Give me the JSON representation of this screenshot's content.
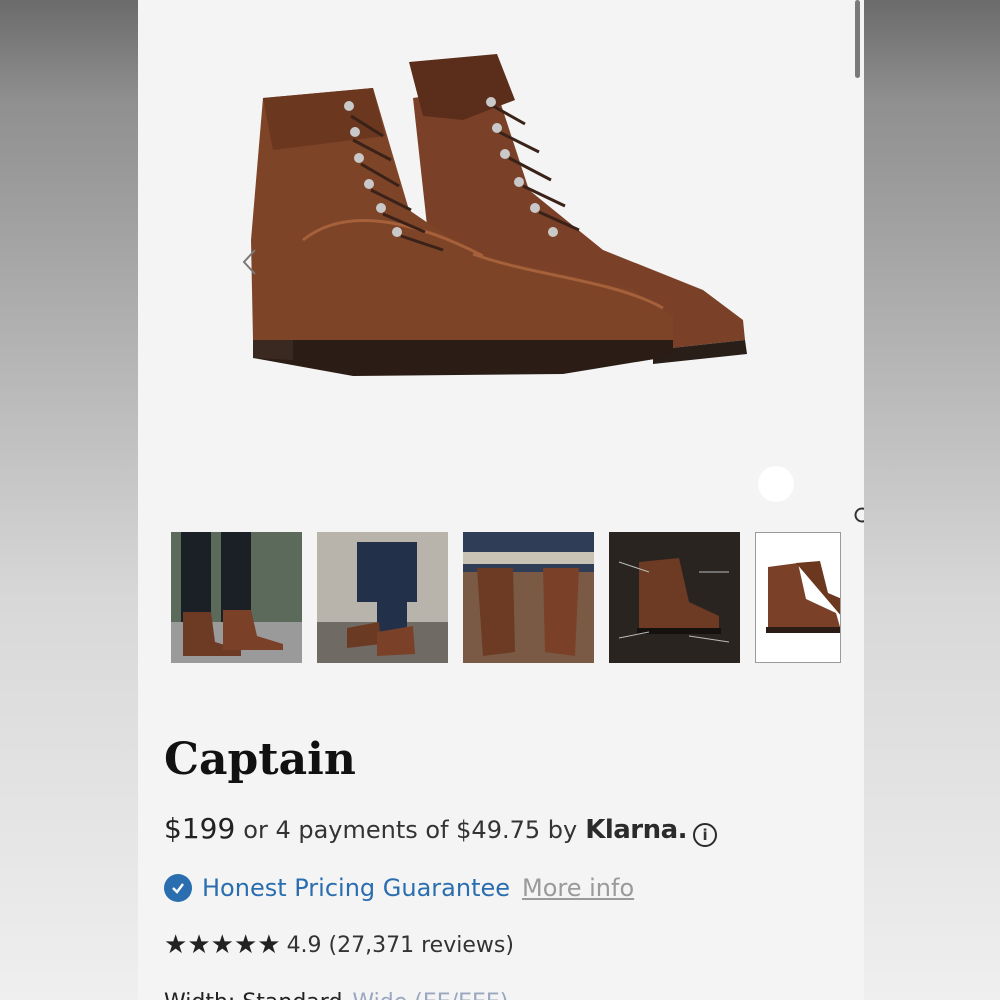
{
  "product": {
    "title": "Captain",
    "price": "$199",
    "installments_text": "or 4 payments of $49.75 by",
    "klarna_label": "Klarna.",
    "info_symbol": "i"
  },
  "guarantee": {
    "label": "Honest Pricing Guarantee",
    "link": "More info"
  },
  "rating": {
    "value": 4.9,
    "text": "4.9 (27,371 reviews)",
    "stars_filled": 5,
    "star_glyph": "★"
  },
  "width_row": {
    "label": "Width: Standard",
    "alt": "Wide (EE/EEE)"
  },
  "gallery": {
    "thumbnail_count": 5,
    "active_index": 4
  },
  "icons": {
    "prev": "chevron-left-icon",
    "next": "chevron-right-icon",
    "zoom": "magnifier-icon",
    "verified": "check-badge-icon"
  },
  "colors": {
    "accent_blue": "#2a6eb0",
    "boot_brown": "#6a3a24",
    "link_gray": "#9a9a9a"
  }
}
